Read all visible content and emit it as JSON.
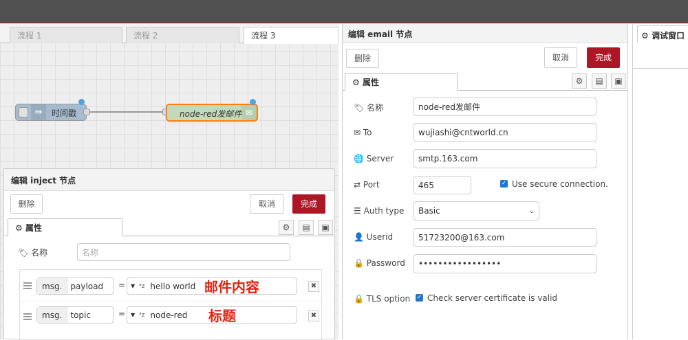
{
  "workspace": {
    "tabs": [
      "流程 1",
      "流程 2",
      "流程 3"
    ],
    "nodes": {
      "inject_label": "时间戳",
      "email_label": "node-red发邮件"
    }
  },
  "inject_editor": {
    "title": "编辑 inject 节点",
    "delete_label": "删除",
    "cancel_label": "取消",
    "done_label": "完成",
    "props_tab": "属性",
    "name_label": "名称",
    "name_placeholder": "名称",
    "rows": [
      {
        "prefix": "msg.",
        "property": "payload",
        "eq": "=",
        "type_icon": "az",
        "value": "hello world",
        "annotation": "邮件内容"
      },
      {
        "prefix": "msg.",
        "property": "topic",
        "eq": "=",
        "type_icon": "az",
        "value": "node-red",
        "annotation": "标题"
      }
    ]
  },
  "email_editor": {
    "title": "编辑 email 节点",
    "delete_label": "删除",
    "cancel_label": "取消",
    "done_label": "完成",
    "props_tab": "属性",
    "fields": {
      "name": {
        "label": "名称",
        "value": "node-red发邮件"
      },
      "to": {
        "label": "To",
        "value": "wujiashi@cntworld.cn"
      },
      "server": {
        "label": "Server",
        "value": "smtp.163.com"
      },
      "port": {
        "label": "Port",
        "value": "465",
        "secure_label": "Use secure connection."
      },
      "auth": {
        "label": "Auth type",
        "value": "Basic"
      },
      "userid": {
        "label": "Userid",
        "value": "51723200@163.com"
      },
      "password": {
        "label": "Password",
        "value": "•••••••••••••••••"
      },
      "tls": {
        "label": "TLS option",
        "check_label": "Check server certificate is valid"
      }
    }
  },
  "sidebar": {
    "tab_label": "调试窗口"
  },
  "colors": {
    "accent": "#ad1625",
    "topbar": "#505050",
    "checkbox": "#1f77d0",
    "annotation": "#e8200f"
  }
}
